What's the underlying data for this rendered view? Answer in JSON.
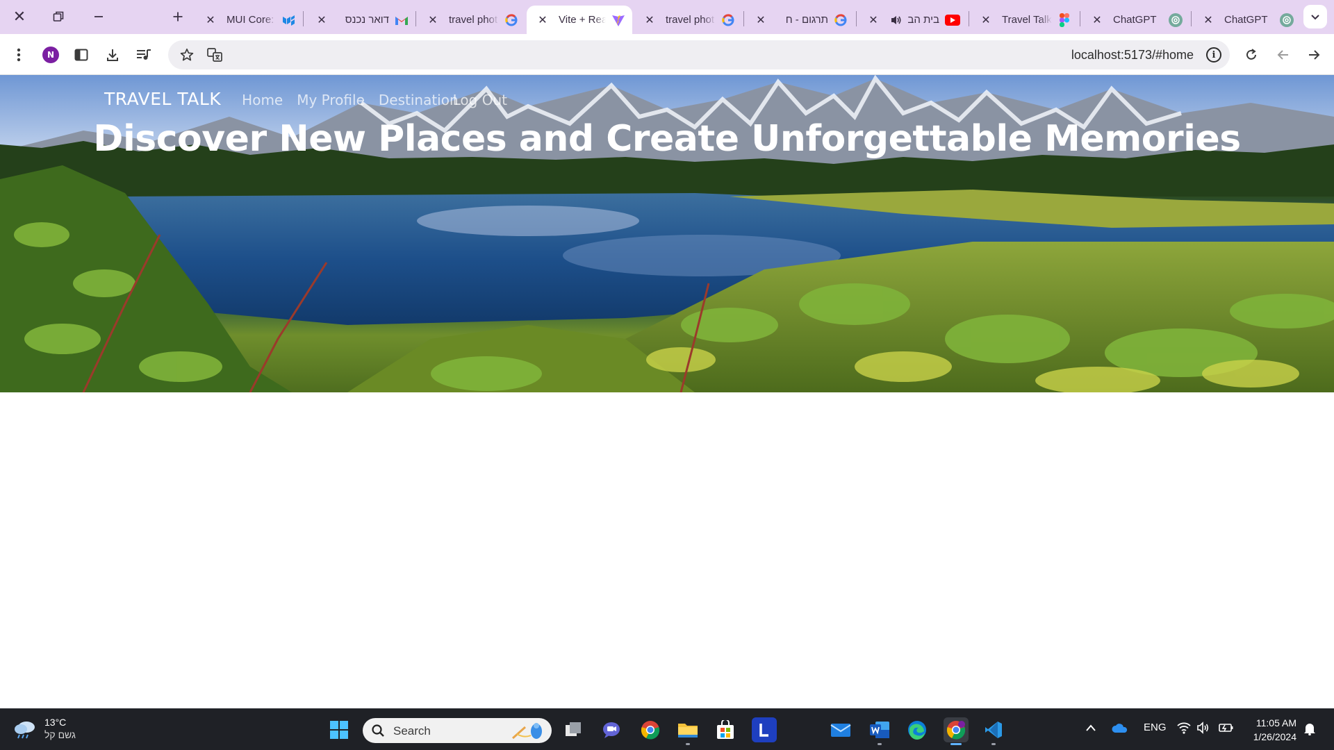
{
  "browser": {
    "tabs": [
      {
        "title": "MUI Core:",
        "favicon": "mui-icon",
        "active": false
      },
      {
        "title": "דואר נכנס",
        "favicon": "gmail-icon",
        "active": false
      },
      {
        "title": "travel phot",
        "favicon": "google-icon",
        "active": false
      },
      {
        "title": "Vite + Rea",
        "favicon": "vite-icon",
        "active": true
      },
      {
        "title": "travel phot",
        "favicon": "google-icon",
        "active": false
      },
      {
        "title": "תרגום - ח",
        "favicon": "google-icon",
        "active": false
      },
      {
        "title": "בית הב",
        "favicon": "youtube-icon",
        "active": false
      },
      {
        "title": "Travel Talk",
        "favicon": "figma-icon",
        "active": false
      },
      {
        "title": "ChatGPT",
        "favicon": "chatgpt-icon",
        "active": false
      },
      {
        "title": "ChatGPT",
        "favicon": "chatgpt-icon",
        "active": false
      }
    ],
    "profile_initial": "N",
    "url": "localhost:5173/#home"
  },
  "site": {
    "brand": "TRAVEL TALK",
    "nav": [
      "Home",
      "My Profile",
      "Destination",
      "Log Out"
    ],
    "headline": "Discover New Places and Create Unforgettable Memories"
  },
  "taskbar": {
    "weather": {
      "temp": "13°C",
      "desc": "גשם קל"
    },
    "search_placeholder": "Search",
    "language": "ENG",
    "time": "11:05 AM",
    "date": "1/26/2024"
  },
  "colors": {
    "tabstrip": "#e6d4f2",
    "taskbar": "#1f2126",
    "profile": "#7b1fa2"
  }
}
